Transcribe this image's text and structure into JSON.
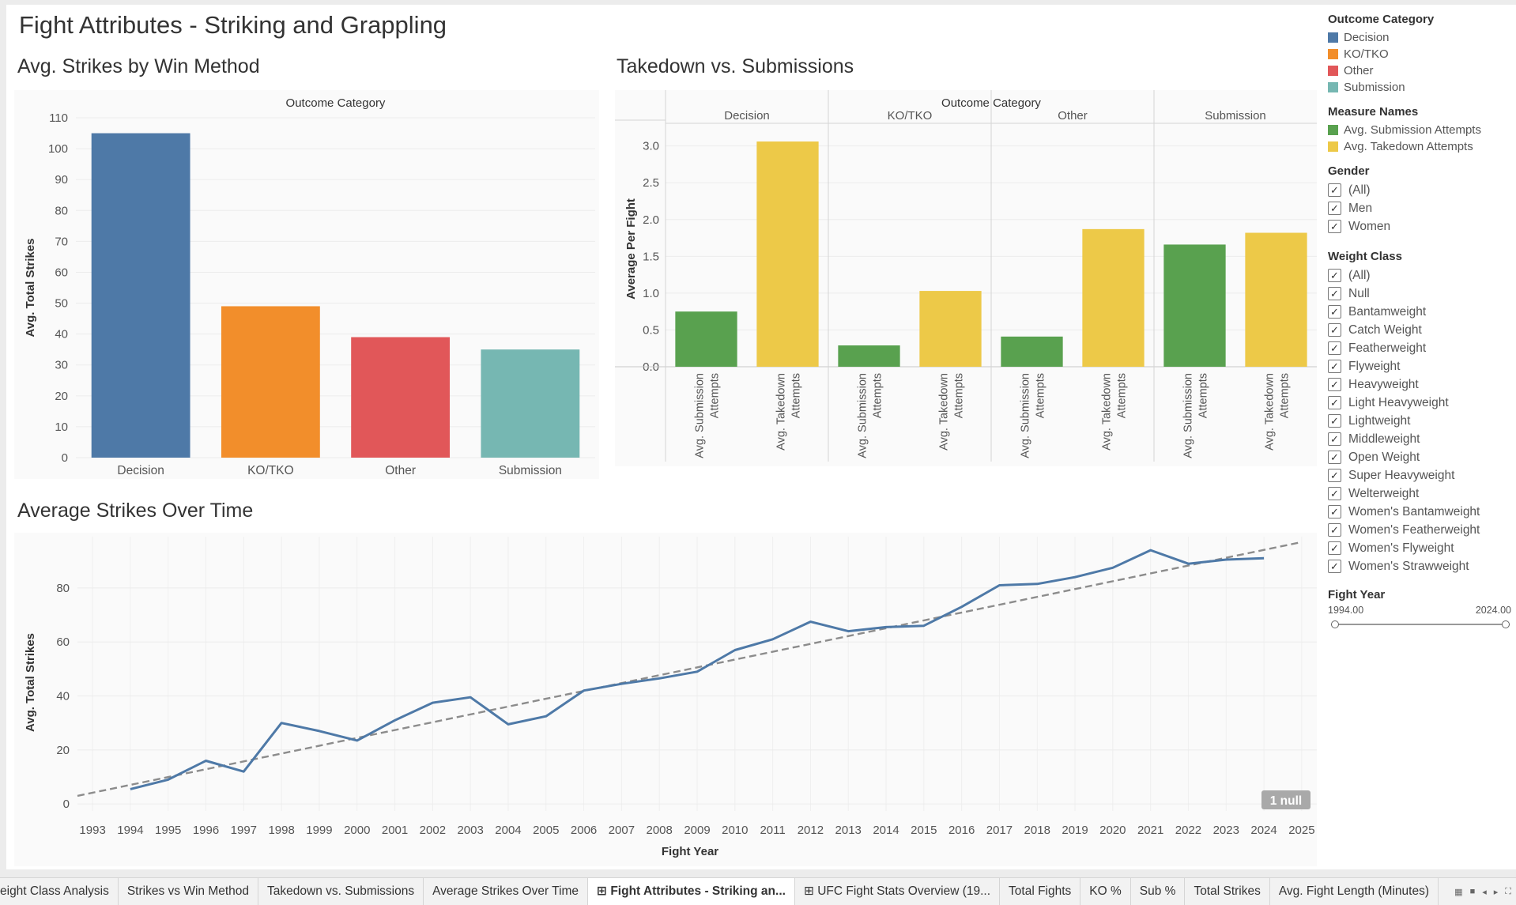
{
  "dashboard": {
    "title": "Fight Attributes - Striking and Grappling"
  },
  "strikes_by_method": {
    "title": "Avg. Strikes by Win Method",
    "header": "Outcome Category"
  },
  "takedown": {
    "title": "Takedown vs. Submissions",
    "header": "Outcome Category",
    "measure_labels": [
      "Avg. Submission Attempts",
      "Avg. Takedown Attempts"
    ]
  },
  "over_time": {
    "title": "Average Strikes Over Time",
    "null_badge": "1 null"
  },
  "colors": {
    "decision": "#4e79a7",
    "ko_tko": "#f28e2b",
    "other": "#e15759",
    "submission": "#76b7b2",
    "sub_attempts": "#59a14f",
    "takedown_attempts": "#edc948",
    "line": "#4e79a7",
    "trend": "#8c8c8c"
  },
  "chart_data": [
    {
      "type": "bar",
      "title": "Avg. Strikes by Win Method",
      "xlabel": "",
      "ylabel": "Avg. Total Strikes",
      "categories": [
        "Decision",
        "KO/TKO",
        "Other",
        "Submission"
      ],
      "values": [
        105,
        49,
        39,
        35
      ],
      "ylim": [
        0,
        110
      ],
      "yticks": [
        0,
        10,
        20,
        30,
        40,
        50,
        60,
        70,
        80,
        90,
        100,
        110
      ],
      "grid": true
    },
    {
      "type": "bar",
      "title": "Takedown vs. Submissions",
      "ylabel": "Average Per Fight",
      "categories": [
        "Decision",
        "KO/TKO",
        "Other",
        "Submission"
      ],
      "series": [
        {
          "name": "Avg. Submission Attempts",
          "values": [
            0.75,
            0.29,
            0.41,
            1.66
          ]
        },
        {
          "name": "Avg. Takedown Attempts",
          "values": [
            3.06,
            1.03,
            1.87,
            1.82
          ]
        }
      ],
      "ylim": [
        0,
        3.2
      ],
      "yticks": [
        0.0,
        0.5,
        1.0,
        1.5,
        2.0,
        2.5,
        3.0
      ],
      "grid": true
    },
    {
      "type": "line",
      "title": "Average Strikes Over Time",
      "xlabel": "Fight Year",
      "ylabel": "Avg. Total Strikes",
      "x": [
        1994,
        1995,
        1996,
        1997,
        1998,
        1999,
        2000,
        2001,
        2002,
        2003,
        2004,
        2005,
        2006,
        2007,
        2008,
        2009,
        2010,
        2011,
        2012,
        2013,
        2014,
        2015,
        2016,
        2017,
        2018,
        2019,
        2020,
        2021,
        2022,
        2023,
        2024
      ],
      "y": [
        5.5,
        9,
        16,
        12,
        30,
        27,
        23.5,
        31,
        37.5,
        39.5,
        29.5,
        32.5,
        42,
        44.5,
        46.5,
        49,
        57,
        61,
        67.5,
        64,
        65.5,
        66,
        73,
        81,
        81.5,
        84,
        87.5,
        94,
        89,
        90.5,
        91
      ],
      "xticks": [
        1993,
        1994,
        1995,
        1996,
        1997,
        1998,
        1999,
        2000,
        2001,
        2002,
        2003,
        2004,
        2005,
        2006,
        2007,
        2008,
        2009,
        2010,
        2011,
        2012,
        2013,
        2014,
        2015,
        2016,
        2017,
        2018,
        2019,
        2020,
        2021,
        2022,
        2023,
        2024,
        2025
      ],
      "yticks": [
        0,
        20,
        40,
        60,
        80
      ],
      "xlim": [
        1992.6,
        2025.4
      ],
      "ylim": [
        -2,
        99
      ],
      "trend_line": {
        "x": [
          1992.6,
          2025
        ],
        "y": [
          3,
          97
        ]
      },
      "grid": true
    }
  ],
  "legend": {
    "outcome": {
      "title": "Outcome Category",
      "items": [
        {
          "label": "Decision",
          "color": "#4e79a7"
        },
        {
          "label": "KO/TKO",
          "color": "#f28e2b"
        },
        {
          "label": "Other",
          "color": "#e15759"
        },
        {
          "label": "Submission",
          "color": "#76b7b2"
        }
      ]
    },
    "measures": {
      "title": "Measure Names",
      "items": [
        {
          "label": "Avg. Submission Attempts",
          "color": "#59a14f"
        },
        {
          "label": "Avg. Takedown Attempts",
          "color": "#edc948"
        }
      ]
    }
  },
  "filters": {
    "gender": {
      "title": "Gender",
      "options": [
        "(All)",
        "Men",
        "Women"
      ]
    },
    "weight_class": {
      "title": "Weight Class",
      "options": [
        "(All)",
        "Null",
        "Bantamweight",
        "Catch Weight",
        "Featherweight",
        "Flyweight",
        "Heavyweight",
        "Light Heavyweight",
        "Lightweight",
        "Middleweight",
        "Open Weight",
        "Super Heavyweight",
        "Welterweight",
        "Women's Bantamweight",
        "Women's Featherweight",
        "Women's Flyweight",
        "Women's Strawweight"
      ]
    },
    "fight_year": {
      "title": "Fight Year",
      "min_label": "1994.00",
      "max_label": "2024.00"
    }
  },
  "tabs": [
    {
      "label": "eight Class Analysis",
      "active": false
    },
    {
      "label": "Strikes vs Win Method",
      "active": false
    },
    {
      "label": "Takedown vs. Submissions",
      "active": false
    },
    {
      "label": "Average Strikes Over Time",
      "active": false
    },
    {
      "label": "⊞ Fight Attributes - Striking an...",
      "active": true
    },
    {
      "label": "⊞ UFC Fight Stats Overview (19...",
      "active": false
    },
    {
      "label": "Total Fights",
      "active": false
    },
    {
      "label": "KO %",
      "active": false
    },
    {
      "label": "Sub %",
      "active": false
    },
    {
      "label": "Total Strikes",
      "active": false
    },
    {
      "label": "Avg. Fight Length (Minutes)",
      "active": false
    }
  ]
}
